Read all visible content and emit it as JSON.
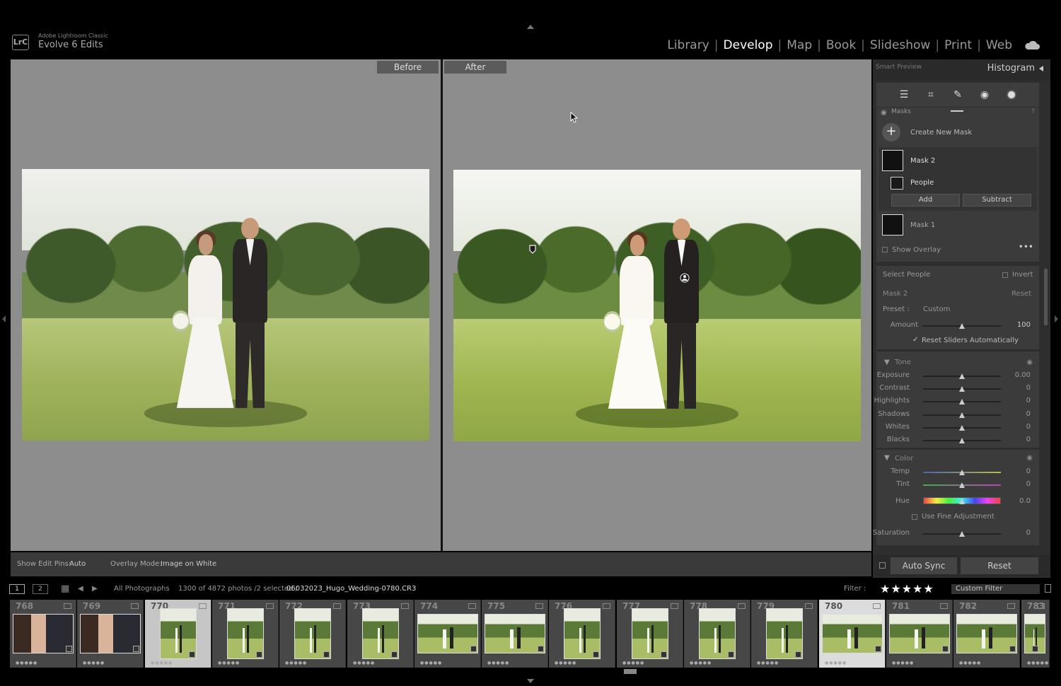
{
  "app": {
    "name": "Adobe Lightroom Classic",
    "catalog": "Evolve 6 Edits",
    "logo": "LrC"
  },
  "modules": [
    "Library",
    "Develop",
    "Map",
    "Book",
    "Slideshow",
    "Print",
    "Web"
  ],
  "active_module": "Develop",
  "viewer": {
    "before_label": "Before",
    "after_label": "After"
  },
  "toolbar": {
    "edit_pins_label": "Show Edit Pins:",
    "edit_pins_value": "Auto",
    "overlay_label": "Overlay Mode:",
    "overlay_value": "Image on White"
  },
  "right_panel": {
    "smart_preview": "Smart Preview",
    "histogram": "Histogram",
    "masks_title": "Masks",
    "create_mask": "Create New Mask",
    "mask2": "Mask 2",
    "people": "People",
    "add": "Add",
    "subtract": "Subtract",
    "mask1": "Mask 1",
    "show_overlay": "Show Overlay",
    "select_people": "Select People",
    "invert": "Invert",
    "mask_name": "Mask 2",
    "reset": "Reset",
    "preset_label": "Preset :",
    "preset_value": "Custom",
    "amount_label": "Amount",
    "amount_value": "100",
    "reset_sliders": "Reset Sliders Automatically",
    "tone_title": "Tone",
    "tone": [
      {
        "label": "Exposure",
        "value": "0.00"
      },
      {
        "label": "Contrast",
        "value": "0"
      },
      {
        "label": "Highlights",
        "value": "0"
      },
      {
        "label": "Shadows",
        "value": "0"
      },
      {
        "label": "Whites",
        "value": "0"
      },
      {
        "label": "Blacks",
        "value": "0"
      }
    ],
    "color_title": "Color",
    "color": [
      {
        "label": "Temp",
        "value": "0"
      },
      {
        "label": "Tint",
        "value": "0"
      },
      {
        "label": "Hue",
        "value": "0.0"
      }
    ],
    "fine_adjust": "Use Fine Adjustment",
    "saturation_label": "Saturation",
    "saturation_value": "0",
    "auto_sync": "Auto Sync",
    "reset_btn": "Reset"
  },
  "filmstrip_bar": {
    "page1": "1",
    "page2": "2",
    "source": "All Photographs",
    "count": "1300 of 4872 photos /2 selected /",
    "filename": "06032023_Hugo_Wedding-0780.CR3",
    "filter_label": "Filter :",
    "stars": "★★★★★",
    "custom_filter": "Custom Filter"
  },
  "filmstrip": [
    {
      "num": "768"
    },
    {
      "num": "769"
    },
    {
      "num": "770"
    },
    {
      "num": "771"
    },
    {
      "num": "772"
    },
    {
      "num": "773"
    },
    {
      "num": "774"
    },
    {
      "num": "775"
    },
    {
      "num": "776"
    },
    {
      "num": "777"
    },
    {
      "num": "778"
    },
    {
      "num": "779"
    },
    {
      "num": "780"
    },
    {
      "num": "781"
    },
    {
      "num": "782"
    },
    {
      "num": "783"
    }
  ]
}
